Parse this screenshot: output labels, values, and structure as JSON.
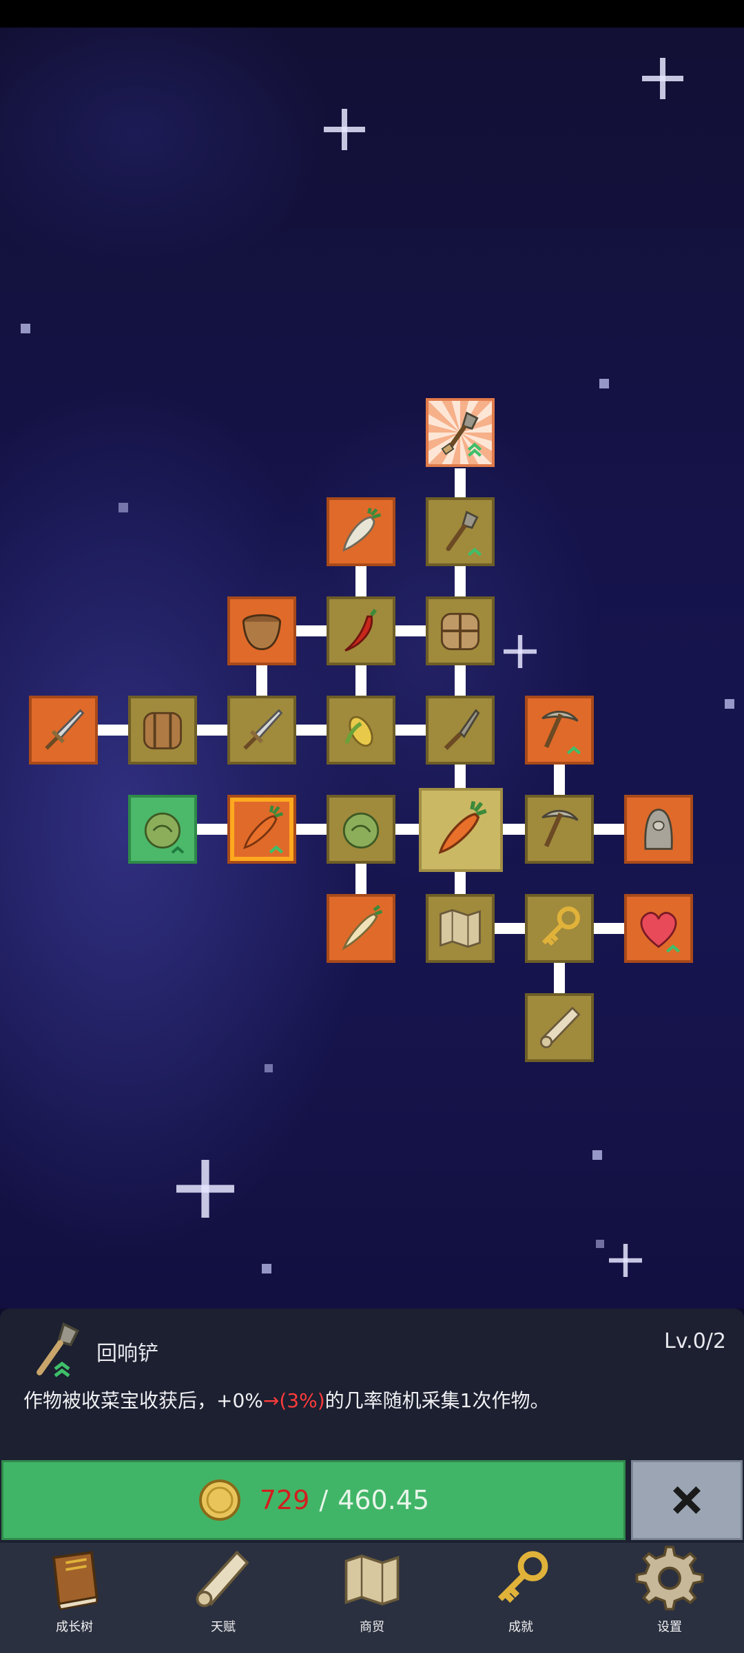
{
  "skill": {
    "name": "回响铲",
    "level": "Lv.0/2",
    "description_before": "作物被收菜宝收获后，+0%",
    "description_arrow": "→(3%)",
    "description_after": "的几率随机采集1次作物。"
  },
  "cost": {
    "have": "729",
    "separator": "/",
    "need": "460.45"
  },
  "nav": [
    {
      "label": "成长树",
      "icon": "book-icon"
    },
    {
      "label": "天赋",
      "icon": "scroll-icon"
    },
    {
      "label": "商贸",
      "icon": "map-icon"
    },
    {
      "label": "成就",
      "icon": "key-icon"
    },
    {
      "label": "设置",
      "icon": "gear-icon"
    }
  ],
  "colors": {
    "buy_green": "#41b567",
    "cost_red": "#d21e1e",
    "node_tan": "#a08a3c",
    "node_orange": "#e06a2a",
    "node_green": "#4cb86a"
  }
}
